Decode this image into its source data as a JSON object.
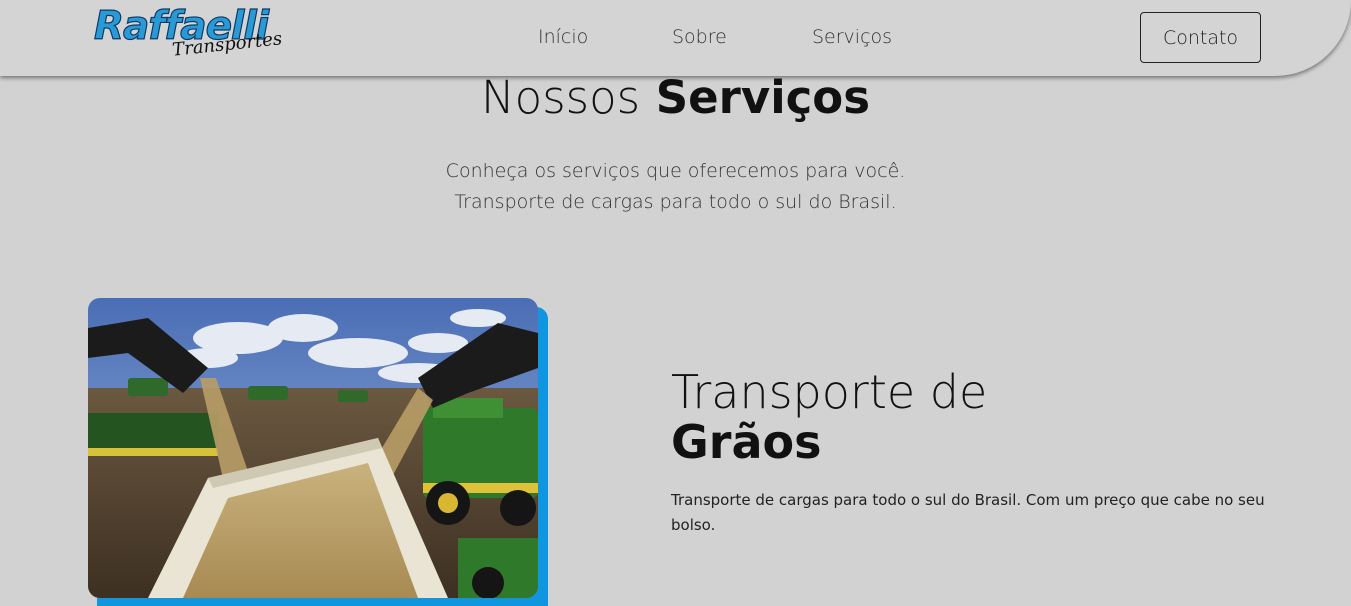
{
  "header": {
    "logo_main": "Raffaelli",
    "logo_sub": "Transportes",
    "nav": [
      "Início",
      "Sobre",
      "Serviços"
    ],
    "contact_label": "Contato"
  },
  "section": {
    "title_light": "Nossos",
    "title_bold": "Serviços",
    "subtitle_line1": "Conheça os serviços que oferecemos para você.",
    "subtitle_line2": "Transporte de cargas para todo o sul do Brasil."
  },
  "service": {
    "title_line1": "Transporte de",
    "title_line2": "Grãos",
    "description": "Transporte de cargas para todo o sul do Brasil. Com um preço que cabe no seu bolso."
  },
  "colors": {
    "background": "#d2d2d2",
    "accent": "#0f96de",
    "logo_blue": "#2a9ad6"
  }
}
